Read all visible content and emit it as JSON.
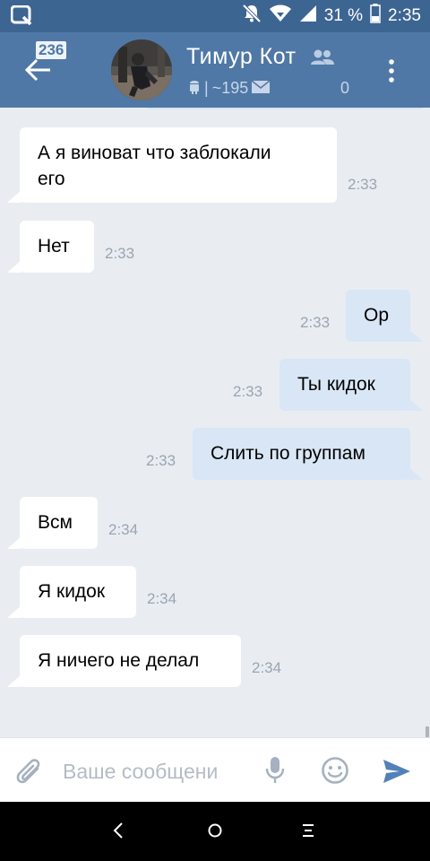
{
  "status_bar": {
    "battery": "31 %",
    "time": "2:35"
  },
  "header": {
    "unread_badge": "236",
    "title": "Тимур Кот",
    "subtitle_count": "~195",
    "subtitle_separator": "|",
    "subtitle_extra": "0"
  },
  "messages": [
    {
      "text": "А я виноват что заблокали его",
      "line1": "А я виноват что заблокали",
      "line2": "его",
      "time": "2:33",
      "direction": "in"
    },
    {
      "text": "Нет",
      "time": "2:33",
      "direction": "in"
    },
    {
      "text": "Ор",
      "time": "2:33",
      "direction": "out"
    },
    {
      "text": "Ты кидок",
      "time": "2:33",
      "direction": "out"
    },
    {
      "text": "Слить по группам",
      "time": "2:33",
      "direction": "out"
    },
    {
      "text": "Всм",
      "time": "2:34",
      "direction": "in"
    },
    {
      "text": "Я кидок",
      "time": "2:34",
      "direction": "in"
    },
    {
      "text": "Я ничего не делал",
      "time": "2:34",
      "direction": "in"
    }
  ],
  "composer": {
    "placeholder": "Ваше сообщени"
  },
  "colors": {
    "status_bar": "#3d6592",
    "header": "#4f78a6",
    "chat_background": "#e9edf2",
    "incoming_bubble": "#ffffff",
    "outgoing_bubble": "#d8e6f5",
    "accent": "#5181b8"
  },
  "icons": {
    "status_left": "search-app-icon",
    "status_right": [
      "muted-bell-icon",
      "wifi-icon",
      "signal-icon",
      "battery-icon"
    ],
    "header": [
      "back-arrow-icon",
      "friends-icon",
      "android-icon",
      "mail-icon",
      "more-vertical-icon"
    ],
    "composer": [
      "paperclip-icon",
      "microphone-icon",
      "emoji-icon",
      "send-icon"
    ],
    "navigation": [
      "nav-back-icon",
      "nav-home-icon",
      "nav-menu-icon"
    ]
  }
}
